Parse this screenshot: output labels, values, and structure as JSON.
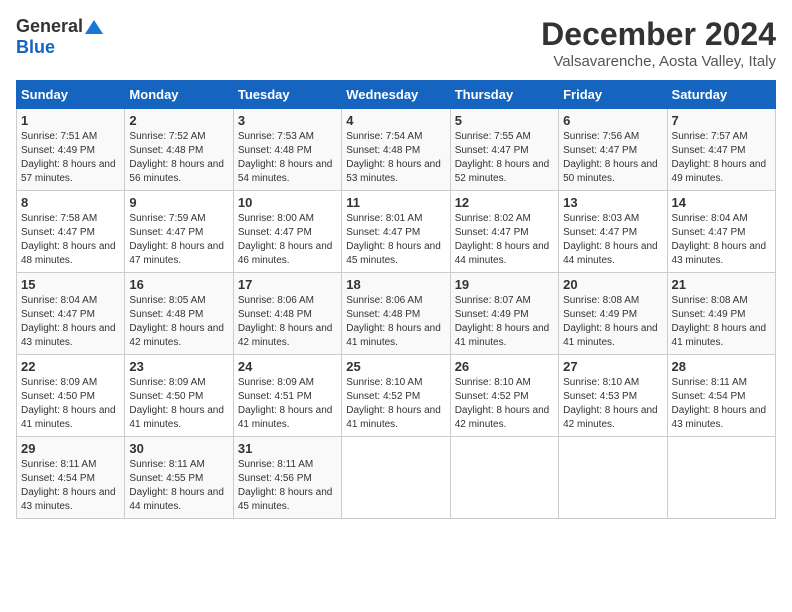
{
  "logo": {
    "general": "General",
    "blue": "Blue"
  },
  "title": "December 2024",
  "location": "Valsavarenche, Aosta Valley, Italy",
  "days_of_week": [
    "Sunday",
    "Monday",
    "Tuesday",
    "Wednesday",
    "Thursday",
    "Friday",
    "Saturday"
  ],
  "weeks": [
    [
      {
        "day": "1",
        "sunrise": "Sunrise: 7:51 AM",
        "sunset": "Sunset: 4:49 PM",
        "daylight": "Daylight: 8 hours and 57 minutes."
      },
      {
        "day": "2",
        "sunrise": "Sunrise: 7:52 AM",
        "sunset": "Sunset: 4:48 PM",
        "daylight": "Daylight: 8 hours and 56 minutes."
      },
      {
        "day": "3",
        "sunrise": "Sunrise: 7:53 AM",
        "sunset": "Sunset: 4:48 PM",
        "daylight": "Daylight: 8 hours and 54 minutes."
      },
      {
        "day": "4",
        "sunrise": "Sunrise: 7:54 AM",
        "sunset": "Sunset: 4:48 PM",
        "daylight": "Daylight: 8 hours and 53 minutes."
      },
      {
        "day": "5",
        "sunrise": "Sunrise: 7:55 AM",
        "sunset": "Sunset: 4:47 PM",
        "daylight": "Daylight: 8 hours and 52 minutes."
      },
      {
        "day": "6",
        "sunrise": "Sunrise: 7:56 AM",
        "sunset": "Sunset: 4:47 PM",
        "daylight": "Daylight: 8 hours and 50 minutes."
      },
      {
        "day": "7",
        "sunrise": "Sunrise: 7:57 AM",
        "sunset": "Sunset: 4:47 PM",
        "daylight": "Daylight: 8 hours and 49 minutes."
      }
    ],
    [
      {
        "day": "8",
        "sunrise": "Sunrise: 7:58 AM",
        "sunset": "Sunset: 4:47 PM",
        "daylight": "Daylight: 8 hours and 48 minutes."
      },
      {
        "day": "9",
        "sunrise": "Sunrise: 7:59 AM",
        "sunset": "Sunset: 4:47 PM",
        "daylight": "Daylight: 8 hours and 47 minutes."
      },
      {
        "day": "10",
        "sunrise": "Sunrise: 8:00 AM",
        "sunset": "Sunset: 4:47 PM",
        "daylight": "Daylight: 8 hours and 46 minutes."
      },
      {
        "day": "11",
        "sunrise": "Sunrise: 8:01 AM",
        "sunset": "Sunset: 4:47 PM",
        "daylight": "Daylight: 8 hours and 45 minutes."
      },
      {
        "day": "12",
        "sunrise": "Sunrise: 8:02 AM",
        "sunset": "Sunset: 4:47 PM",
        "daylight": "Daylight: 8 hours and 44 minutes."
      },
      {
        "day": "13",
        "sunrise": "Sunrise: 8:03 AM",
        "sunset": "Sunset: 4:47 PM",
        "daylight": "Daylight: 8 hours and 44 minutes."
      },
      {
        "day": "14",
        "sunrise": "Sunrise: 8:04 AM",
        "sunset": "Sunset: 4:47 PM",
        "daylight": "Daylight: 8 hours and 43 minutes."
      }
    ],
    [
      {
        "day": "15",
        "sunrise": "Sunrise: 8:04 AM",
        "sunset": "Sunset: 4:47 PM",
        "daylight": "Daylight: 8 hours and 43 minutes."
      },
      {
        "day": "16",
        "sunrise": "Sunrise: 8:05 AM",
        "sunset": "Sunset: 4:48 PM",
        "daylight": "Daylight: 8 hours and 42 minutes."
      },
      {
        "day": "17",
        "sunrise": "Sunrise: 8:06 AM",
        "sunset": "Sunset: 4:48 PM",
        "daylight": "Daylight: 8 hours and 42 minutes."
      },
      {
        "day": "18",
        "sunrise": "Sunrise: 8:06 AM",
        "sunset": "Sunset: 4:48 PM",
        "daylight": "Daylight: 8 hours and 41 minutes."
      },
      {
        "day": "19",
        "sunrise": "Sunrise: 8:07 AM",
        "sunset": "Sunset: 4:49 PM",
        "daylight": "Daylight: 8 hours and 41 minutes."
      },
      {
        "day": "20",
        "sunrise": "Sunrise: 8:08 AM",
        "sunset": "Sunset: 4:49 PM",
        "daylight": "Daylight: 8 hours and 41 minutes."
      },
      {
        "day": "21",
        "sunrise": "Sunrise: 8:08 AM",
        "sunset": "Sunset: 4:49 PM",
        "daylight": "Daylight: 8 hours and 41 minutes."
      }
    ],
    [
      {
        "day": "22",
        "sunrise": "Sunrise: 8:09 AM",
        "sunset": "Sunset: 4:50 PM",
        "daylight": "Daylight: 8 hours and 41 minutes."
      },
      {
        "day": "23",
        "sunrise": "Sunrise: 8:09 AM",
        "sunset": "Sunset: 4:50 PM",
        "daylight": "Daylight: 8 hours and 41 minutes."
      },
      {
        "day": "24",
        "sunrise": "Sunrise: 8:09 AM",
        "sunset": "Sunset: 4:51 PM",
        "daylight": "Daylight: 8 hours and 41 minutes."
      },
      {
        "day": "25",
        "sunrise": "Sunrise: 8:10 AM",
        "sunset": "Sunset: 4:52 PM",
        "daylight": "Daylight: 8 hours and 41 minutes."
      },
      {
        "day": "26",
        "sunrise": "Sunrise: 8:10 AM",
        "sunset": "Sunset: 4:52 PM",
        "daylight": "Daylight: 8 hours and 42 minutes."
      },
      {
        "day": "27",
        "sunrise": "Sunrise: 8:10 AM",
        "sunset": "Sunset: 4:53 PM",
        "daylight": "Daylight: 8 hours and 42 minutes."
      },
      {
        "day": "28",
        "sunrise": "Sunrise: 8:11 AM",
        "sunset": "Sunset: 4:54 PM",
        "daylight": "Daylight: 8 hours and 43 minutes."
      }
    ],
    [
      {
        "day": "29",
        "sunrise": "Sunrise: 8:11 AM",
        "sunset": "Sunset: 4:54 PM",
        "daylight": "Daylight: 8 hours and 43 minutes."
      },
      {
        "day": "30",
        "sunrise": "Sunrise: 8:11 AM",
        "sunset": "Sunset: 4:55 PM",
        "daylight": "Daylight: 8 hours and 44 minutes."
      },
      {
        "day": "31",
        "sunrise": "Sunrise: 8:11 AM",
        "sunset": "Sunset: 4:56 PM",
        "daylight": "Daylight: 8 hours and 45 minutes."
      },
      null,
      null,
      null,
      null
    ]
  ]
}
